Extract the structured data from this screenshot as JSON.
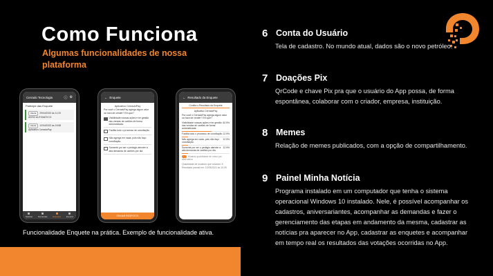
{
  "header": {
    "title": "Como Funciona",
    "subtitle": "Algumas funcionalidades de nossa plataforma"
  },
  "caption": "Funcionalidade Enquete na prática. Exemplo de funcionalidade ativa.",
  "colors": {
    "accent": "#f2862e",
    "background": "#000000",
    "text": "#ffffff"
  },
  "logo": {
    "icon": "cerradopay-logo-icon"
  },
  "items": [
    {
      "number": "6",
      "title": "Conta do Usuário",
      "description": "Tela de cadastro. No mundo atual, dados são o novo petróleo."
    },
    {
      "number": "7",
      "title": "Doações Pix",
      "description": "QrCode e chave Pix pra que o usuário do App possa, de forma espontânea, colaborar com o criador, empresa, instituição."
    },
    {
      "number": "8",
      "title": "Memes",
      "description": "Relação de memes publicados, com a opção de compartilhamento."
    },
    {
      "number": "9",
      "title": "Painel Minha Notícia",
      "description": "Programa instalado em um computador que tenha o sistema operacional Windows 10 instalado. Nele, é possível acompanhar os cadastros, aniversariantes, acompanhar as demandas e fazer o gerenciamento das etapas em andamento da mesma, cadastrar as notícias pra aparecer no App, cadastrar as enquetes e acompanhar em tempo real os resultados das votações ocorridas no App."
    }
  ],
  "phone1": {
    "appbar_title": "Cerrado Tecnologia",
    "section": "Participe das Enquete",
    "cards": [
      {
        "tag": "Aberta",
        "date": "29/04/2022 às 11:20",
        "text": "AVISO AUTOMÁTICO"
      },
      {
        "tag": "Aberta",
        "date": "12/04/2022 às 15:58",
        "text": "Aplicativo CerradoPay"
      }
    ],
    "nav": [
      "Notícias",
      "Demandas",
      "Enquetes",
      "Eventos"
    ]
  },
  "phone2": {
    "appbar_title": "Enquete",
    "poll_title": "Aplicativo CerradoPay",
    "question": "Pra você o CerradoPay agrega algum valor na hora de vender? Em que?",
    "options": [
      {
        "text": "Visibilidade nossas ações e ter gestão das vendas de cartões de forma automatizada.",
        "checked": true
      },
      {
        "text": "Facilita todo o processo de conciliação.",
        "checked": false
      },
      {
        "text": "Não agrega em nada, pois não faço conciliação.",
        "checked": false
      },
      {
        "text": "Somente por ser o pedágio atender a alta demanda de cartões por dia.",
        "checked": false
      }
    ],
    "send_label": "ENVIAR RESPOSTA"
  },
  "phone3": {
    "appbar_title": "Resultado da Enquete",
    "tab": "Confira o Resultado da Enquete",
    "poll_title": "Aplicativo CerradoPay",
    "question": "Pra você o CerradoPay agrega algum valor na hora de vender? Em que?",
    "results": [
      {
        "text": "Visibilidade nossas ações e ter gestão das vendas de cartões de forma automatizada.",
        "percent": "62.5%",
        "value": 62.5
      },
      {
        "text": "Facilita todo o processo de conciliação.",
        "percent": "12.5%",
        "value": 12.5
      },
      {
        "text": "Não agrega em nada, pois não faço conciliação.",
        "percent": "12.5%",
        "value": 12.5
      },
      {
        "text": "Somente por ser o pedágio atender a alta demanda de cartões por dia.",
        "percent": "12.5%",
        "value": 12.5
      }
    ],
    "toggle_label": "Mostrar quantidade de votos por alternativa",
    "footer1": "Quantidade de usuários que votaram: 8",
    "footer2": "Resultado parcial em: 12/05/2022 às 10:25"
  }
}
